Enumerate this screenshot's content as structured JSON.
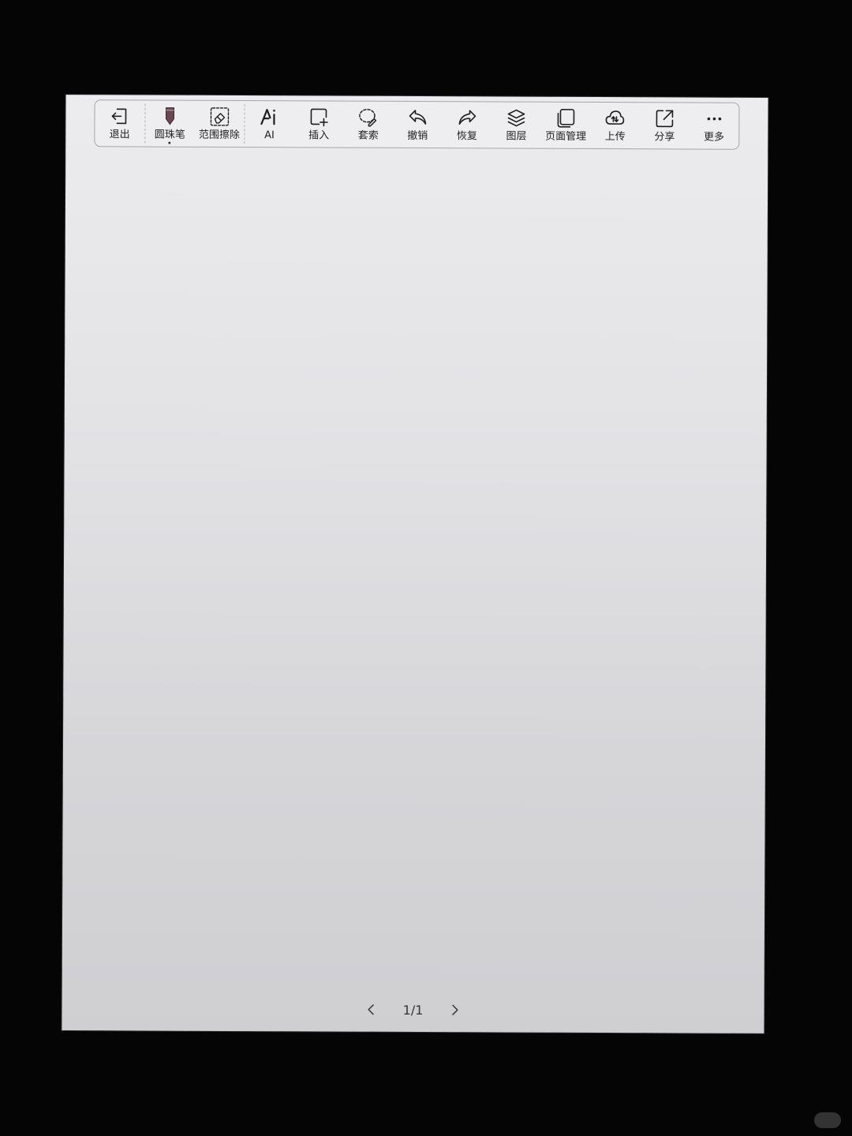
{
  "toolbar": {
    "items": [
      {
        "name": "exit",
        "label": "退出",
        "icon": "exit-icon"
      },
      {
        "name": "ballpoint-pen",
        "label": "圆珠笔",
        "icon": "pen-icon",
        "pen_color": "#6b4650"
      },
      {
        "name": "area-eraser",
        "label": "范围擦除",
        "icon": "eraser-icon"
      },
      {
        "name": "ai",
        "label": "AI",
        "icon": "ai-icon"
      },
      {
        "name": "insert",
        "label": "插入",
        "icon": "insert-icon"
      },
      {
        "name": "lasso",
        "label": "套索",
        "icon": "lasso-icon"
      },
      {
        "name": "undo",
        "label": "撤销",
        "icon": "undo-icon"
      },
      {
        "name": "redo",
        "label": "恢复",
        "icon": "redo-icon"
      },
      {
        "name": "layers",
        "label": "图层",
        "icon": "layers-icon"
      },
      {
        "name": "page-management",
        "label": "页面管理",
        "icon": "pages-icon"
      },
      {
        "name": "upload",
        "label": "上传",
        "icon": "cloud-upload-icon"
      },
      {
        "name": "share",
        "label": "分享",
        "icon": "share-icon"
      },
      {
        "name": "more",
        "label": "更多",
        "icon": "more-icon"
      }
    ]
  },
  "pager": {
    "count": "1/1"
  }
}
